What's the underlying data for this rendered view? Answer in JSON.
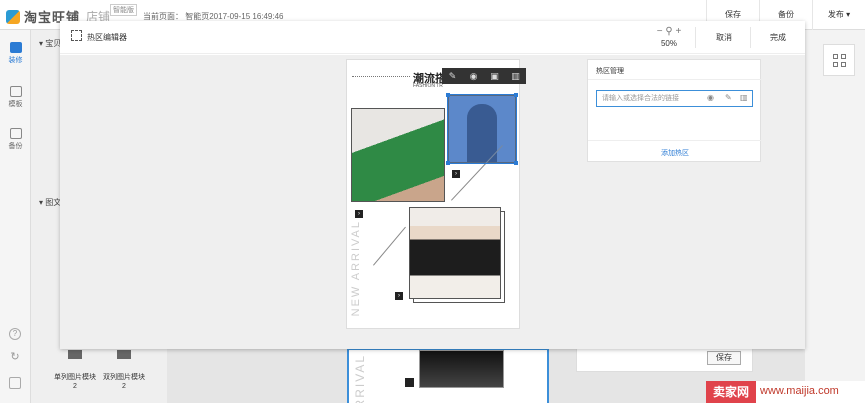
{
  "header": {
    "logo_text": "淘宝旺铺",
    "shop_name": "店铺",
    "badge": "智能版",
    "current_page": "当前页面：  智能页2017-09-15 16:49:46",
    "actions": [
      "保存",
      "备份",
      "发布"
    ]
  },
  "sidebar": {
    "items": [
      {
        "label": "装修",
        "icon": "hammer-icon",
        "active": true
      },
      {
        "label": "模板",
        "icon": "template-icon",
        "active": false
      },
      {
        "label": "备份",
        "icon": "backup-icon",
        "active": false
      }
    ],
    "bottom_icons": [
      "help-icon",
      "refresh-icon",
      "edit-icon"
    ]
  },
  "background": {
    "section_labels": [
      "宝贝",
      "图文"
    ],
    "modules": [
      {
        "label": "单列图片模块",
        "count": "2"
      },
      {
        "label": "双列图片模块",
        "count": "2"
      }
    ],
    "canvas_vertical_text": "ARRIVAL",
    "save_label": "保存"
  },
  "modal": {
    "title": "热区编辑器",
    "zoom": "50%",
    "cancel_label": "取消",
    "done_label": "完成"
  },
  "canvas": {
    "title": "潮流搭配",
    "subtitle": "FASHION TR",
    "vertical_text": "NEW ARRIVAL",
    "arrow_glyph": "›"
  },
  "hotspot_toolbar": {
    "tools": [
      "edit-icon",
      "eye-icon",
      "save-icon",
      "trash-icon"
    ]
  },
  "hotspot_panel": {
    "title": "热区管理",
    "link_placeholder": "请输入或选择合法的链接",
    "link_value": "",
    "add_label": "添加热区"
  },
  "watermark": {
    "badge": "卖家网",
    "url": "www.maijia.com"
  },
  "colors": {
    "accent": "#2b7bd4",
    "hotspot_fill": "#5f86c6"
  }
}
